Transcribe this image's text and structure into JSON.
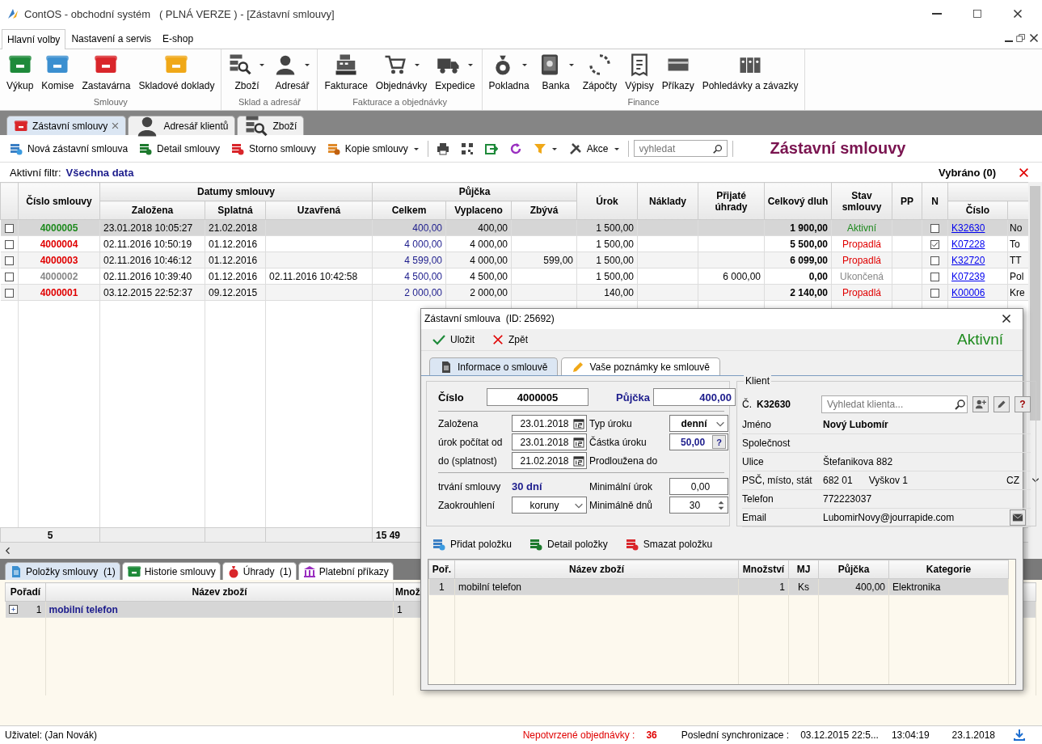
{
  "window": {
    "title": "ContOS - obchodní systém   ( PLNÁ VERZE ) - [Zástavní smlouvy]"
  },
  "ribbon": {
    "tabs": [
      {
        "label": "Hlavní volby",
        "selected": true
      },
      {
        "label": "Nastavení a servis",
        "selected": false
      },
      {
        "label": "E-shop",
        "selected": false
      }
    ],
    "groups": [
      {
        "label": "Smlouvy",
        "buttons": [
          {
            "label": "Výkup",
            "dropdown": false
          },
          {
            "label": "Komise",
            "dropdown": false
          },
          {
            "label": "Zastavárna",
            "dropdown": false
          },
          {
            "label": "Skladové doklady",
            "dropdown": false
          }
        ]
      },
      {
        "label": "Sklad a adresář",
        "buttons": [
          {
            "label": "Zboží",
            "dropdown": true
          },
          {
            "label": "Adresář",
            "dropdown": true
          }
        ]
      },
      {
        "label": "Fakturace a objednávky",
        "buttons": [
          {
            "label": "Fakturace",
            "dropdown": false
          },
          {
            "label": "Objednávky",
            "dropdown": true
          },
          {
            "label": "Expedice",
            "dropdown": true
          }
        ]
      },
      {
        "label": "Finance",
        "buttons": [
          {
            "label": "Pokladna",
            "dropdown": true
          },
          {
            "label": "Banka",
            "dropdown": true
          },
          {
            "label": "Zápočty",
            "dropdown": false
          },
          {
            "label": "Výpisy",
            "dropdown": false
          },
          {
            "label": "Příkazy",
            "dropdown": false
          },
          {
            "label": "Pohledávky a závazky",
            "dropdown": false
          }
        ]
      }
    ]
  },
  "document_tabs": [
    {
      "label": "Zástavní smlouvy",
      "selected": true,
      "closable": true
    },
    {
      "label": "Adresář klientů",
      "selected": false,
      "closable": false
    },
    {
      "label": "Zboží",
      "selected": false,
      "closable": false
    }
  ],
  "toolbar": {
    "buttons": [
      {
        "label": "Nová zástavní smlouva",
        "dropdown": false
      },
      {
        "label": "Detail smlouvy",
        "dropdown": false
      },
      {
        "label": "Storno smlouvy",
        "dropdown": false
      },
      {
        "label": "Kopie smlouvy",
        "dropdown": true
      }
    ],
    "actions": "Akce",
    "search": {
      "placeholder": "vyhledat"
    },
    "title": "Zástavní smlouvy"
  },
  "filter_bar": {
    "label": "Aktivní filtr:",
    "value": "Všechna data",
    "selected_count": "Vybráno (0)"
  },
  "table": {
    "header_groups": [
      "Datumy smlouvy",
      "Půjčka"
    ],
    "columns": {
      "number": "Číslo smlouvy",
      "created": "Založena",
      "due": "Splatná",
      "closed": "Uzavřená",
      "total": "Celkem",
      "paid_out": "Vyplaceno",
      "remaining": "Zbývá",
      "interest": "Úrok",
      "costs": "Náklady",
      "received": "Přijaté úhrady",
      "debt": "Celkový dluh",
      "status": "Stav smlouvy",
      "pp": "PP",
      "n": "N",
      "client": "Číslo"
    },
    "rows": [
      {
        "checked": false,
        "selected": true,
        "kind": "active",
        "number": "4000005",
        "created": "23.01.2018 10:05:27",
        "due": "21.02.2018",
        "total": "400,00",
        "paid_out": "400,00",
        "interest": "1 500,00",
        "debt": "1 900,00",
        "status": "Aktivní",
        "n_checked": false,
        "client": "K32630",
        "column_17": "No"
      },
      {
        "checked": false,
        "selected": false,
        "kind": "forfeited",
        "number": "4000004",
        "created": "02.11.2016 10:50:19",
        "due": "01.12.2016",
        "total": "4 000,00",
        "paid_out": "4 000,00",
        "interest": "1 500,00",
        "debt": "5 500,00",
        "status": "Propadlá",
        "n_checked": true,
        "client": "K07228",
        "column_17": "To"
      },
      {
        "checked": false,
        "selected": false,
        "kind": "forfeited",
        "number": "4000003",
        "created": "02.11.2016 10:46:12",
        "due": "01.12.2016",
        "total": "4 599,00",
        "paid_out": "4 000,00",
        "remaining": "599,00",
        "interest": "1 500,00",
        "debt": "6 099,00",
        "status": "Propadlá",
        "n_checked": false,
        "client": "K32720",
        "column_17": "TT"
      },
      {
        "checked": false,
        "selected": false,
        "kind": "closed",
        "number": "4000002",
        "created": "02.11.2016 10:39:40",
        "due": "01.12.2016",
        "closed": "02.11.2016 10:42:58",
        "total": "4 500,00",
        "paid_out": "4 500,00",
        "interest": "1 500,00",
        "received": "6 000,00",
        "debt": "0,00",
        "status": "Ukončená",
        "n_checked": false,
        "client": "K07239",
        "column_17": "Pol"
      },
      {
        "checked": false,
        "selected": false,
        "kind": "forfeited",
        "number": "4000001",
        "created": "03.12.2015 22:52:37",
        "due": "09.12.2015",
        "total": "2 000,00",
        "paid_out": "2 000,00",
        "interest": "140,00",
        "debt": "2 140,00",
        "status": "Propadlá",
        "n_checked": false,
        "client": "K00006",
        "column_17": "Kre"
      }
    ],
    "footer": {
      "count": "5",
      "total": "15 49"
    }
  },
  "bottom_tabs": [
    {
      "label": "Položky smlouvy  (1)",
      "selected": true
    },
    {
      "label": "Historie smlouvy",
      "selected": false
    },
    {
      "label": "Úhrady  (1)",
      "selected": false
    },
    {
      "label": "Platební příkazy",
      "selected": false
    }
  ],
  "items_grid": {
    "columns": [
      "Pořadí",
      "Název zboží",
      "Množ"
    ],
    "rows": [
      {
        "selected": true,
        "order": "1",
        "name": "mobilní telefon",
        "quantity": "1"
      }
    ]
  },
  "dialog": {
    "title": "Zástavní smlouva  (ID: 25692)",
    "actions": [
      {
        "label": "Uložit",
        "kind": "save"
      },
      {
        "label": "Zpět",
        "kind": "cancel"
      }
    ],
    "status": "Aktivní",
    "tabs": [
      {
        "label": "Informace o smlouvě",
        "selected": true
      },
      {
        "label": "Vaše poznámky ke smlouvě",
        "selected": false
      }
    ],
    "contract": {
      "number_label": "Číslo",
      "number": "4000005",
      "loan_label": "Půjčka",
      "loan": "400,00",
      "fields": [
        {
          "label": "Založena",
          "value": "23.01.2018",
          "kind": "date"
        },
        {
          "label": "Typ úroku",
          "value": "denní",
          "kind": "select",
          "emphasis": true
        },
        {
          "label": "úrok počítat od",
          "value": "23.01.2018",
          "kind": "date"
        },
        {
          "label": "Částka úroku",
          "value": "50,00",
          "kind": "help",
          "help": "?"
        },
        {
          "label": "do (splatnost)",
          "value": "21.02.2018",
          "kind": "date"
        },
        {
          "label": "Prodloužena do",
          "kind": "none"
        }
      ],
      "extra": [
        {
          "label": "trvání smlouvy",
          "value": "30 dní",
          "kind": "text"
        },
        {
          "label": "Minimální úrok",
          "value": "0,00",
          "kind": "input"
        },
        {
          "label": "Zaokrouhlení",
          "value": "koruny",
          "kind": "select",
          "emphasis": false
        },
        {
          "label": "Minimálně dnů",
          "value": "30",
          "kind": "spinner"
        }
      ]
    },
    "client": {
      "title": "Klient",
      "id_label": "Č.",
      "id": "K32630",
      "search": {
        "placeholder": "Vyhledat klienta..."
      },
      "help": "?",
      "rows": [
        {
          "label": "Jméno",
          "values": [
            "Nový Lubomír"
          ],
          "bold": true
        },
        {
          "label": "Společnost"
        },
        {
          "label": "Ulice",
          "values": [
            "Štefanikova 882"
          ],
          "bold": false
        },
        {
          "label": "PSČ, místo, stát",
          "values": [
            "682 01",
            "Vyškov 1",
            "CZ"
          ],
          "bold": false
        },
        {
          "label": "Telefon",
          "values": [
            "772223037"
          ],
          "bold": false
        },
        {
          "label": "Email",
          "values": [
            "LubomirNovy@jourrapide.com"
          ],
          "bold": false,
          "mail": true
        }
      ]
    },
    "item_actions": [
      "Přidat položku",
      "Detail položky",
      "Smazat položku"
    ],
    "items": {
      "columns": [
        "Poř.",
        "Název zboží",
        "Množství",
        "MJ",
        "Půjčka",
        "Kategorie"
      ],
      "rows": [
        {
          "selected": true,
          "cells": [
            "1",
            "mobilní telefon",
            "1",
            "Ks",
            "400,00",
            "Elektronika"
          ]
        }
      ]
    }
  },
  "status_bar": {
    "user": "Uživatel: (Jan Novák)",
    "pending_label": "Nepotvrzené objednávky :",
    "pending_count": "36",
    "sync_label": "Poslední synchronizace :",
    "sync_value": "03.12.2015 22:5...",
    "time": "13:04:19",
    "date": "23.1.2018"
  }
}
